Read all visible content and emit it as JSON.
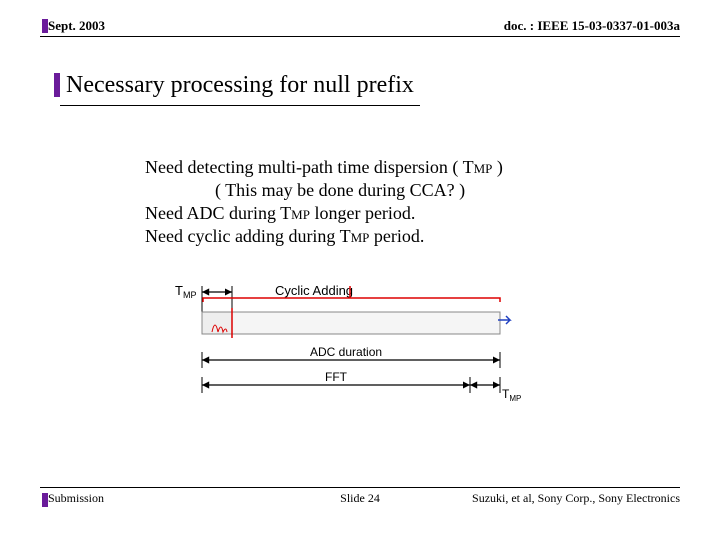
{
  "header": {
    "date": "Sept. 2003",
    "doc_ref": "doc. : IEEE 15-03-0337-01-003a"
  },
  "title": "Necessary processing for null prefix",
  "body": {
    "line1_a": "Need detecting multi-path time dispersion ( T",
    "line1_sub": "MP",
    "line1_b": " )",
    "line2": "( This may be done during CCA? )",
    "line3_a": "Need ADC during T",
    "line3_sub": "MP",
    "line3_b": " longer period.",
    "line4_a": "Need cyclic adding during T",
    "line4_sub": "MP",
    "line4_b": " period."
  },
  "figure": {
    "label_tmp": "T",
    "label_tmp_sub": "MP",
    "label_cyclic": "Cyclic Adding",
    "label_adc": "ADC duration",
    "label_fft": "FFT",
    "label_tmp2": "T",
    "label_tmp2_sub": "MP"
  },
  "footer": {
    "left": "Submission",
    "center": "Slide 24",
    "right": "Suzuki, et al, Sony Corp., Sony Electronics"
  }
}
